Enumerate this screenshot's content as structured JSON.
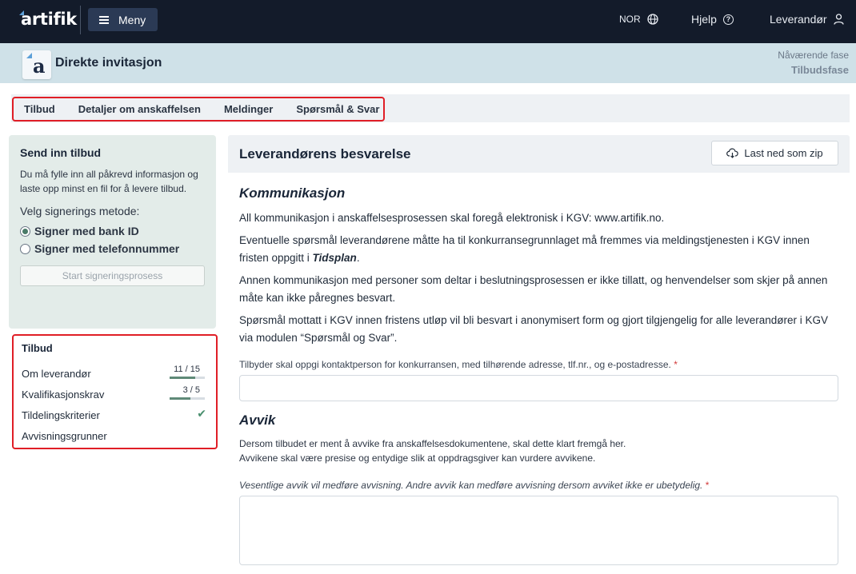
{
  "topbar": {
    "logo": "artifik",
    "menu_label": "Meny",
    "language": "NOR",
    "help_label": "Hjelp",
    "user_label": "Leverandør"
  },
  "subheader": {
    "title": "Direkte invitasjon",
    "phase_label": "Nåværende fase",
    "phase_value": "Tilbudsfase"
  },
  "tabs": [
    {
      "label": "Tilbud"
    },
    {
      "label": "Detaljer om anskaffelsen"
    },
    {
      "label": "Meldinger"
    },
    {
      "label": "Spørsmål & Svar"
    }
  ],
  "submit_panel": {
    "title": "Send inn tilbud",
    "description": "Du må fylle inn all påkrevd informasjon og laste opp minst en fil for å levere tilbud.",
    "sign_method_label": "Velg signerings metode:",
    "options": [
      {
        "label": "Signer med bank ID",
        "checked": true
      },
      {
        "label": "Signer med telefonnummer",
        "checked": false
      }
    ],
    "start_button": "Start signeringsprosess"
  },
  "tilbud_nav": {
    "title": "Tilbud",
    "items": [
      {
        "label": "Om leverandør",
        "count": "11 / 15",
        "progress": 0.73
      },
      {
        "label": "Kvalifikasjonskrav",
        "count": "3 / 5",
        "progress": 0.6
      },
      {
        "label": "Tildelingskriterier",
        "complete": true
      },
      {
        "label": "Avvisningsgrunner"
      }
    ]
  },
  "main": {
    "title": "Leverandørens besvarelse",
    "zip_button": "Last ned som zip",
    "kommunikasjon": {
      "title": "Kommunikasjon",
      "p1": "All kommunikasjon i anskaffelsesprosessen skal foregå elektronisk i KGV: www.artifik.no.",
      "p2_start": "Eventuelle spørsmål leverandørene måtte ha til konkurransegrunnlaget må fremmes via  meldingstjenesten i KGV innen fristen oppgitt i ",
      "p2_bold": "Tidsplan",
      "p2_end": ".",
      "p3": "Annen kommunikasjon med personer som  deltar i beslutningsprosessen er ikke tillatt, og henvendelser som skjer på annen måte kan ikke  påregnes besvart.",
      "p4": "Spørsmål mottatt i KGV innen fristens utløp vil bli besvart i anonymisert form og gjort tilgjengelig for  alle leverandører i KGV via modulen “Spørsmål og Svar”.",
      "field_label": "Tilbyder skal oppgi kontaktperson for konkurransen, med tilhørende  adresse, tlf.nr., og e-postadresse.",
      "field_value": ""
    },
    "avvik": {
      "title": "Avvik",
      "line1": "Dersom tilbudet er ment å avvike fra anskaffelsesdokumentene, skal dette klart fremgå her.",
      "line2": "Avvikene skal være presise og entydige slik at oppdragsgiver kan vurdere avvikene.",
      "field_label": "Vesentlige avvik vil medføre avvisning. Andre avvik kan medføre avvisning dersom avviket ikke er  ubetydelig.",
      "field_value": ""
    },
    "required_marker": "*"
  }
}
